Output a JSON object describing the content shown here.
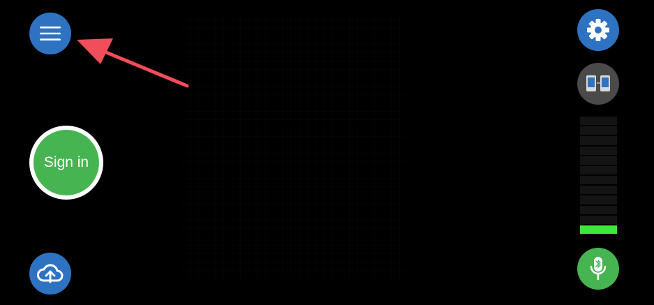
{
  "signin": {
    "label": "Sign in"
  },
  "buttons": {
    "menu_icon": "hamburger-icon",
    "upload_icon": "cloud-upload-icon",
    "settings_icon": "gear-icon",
    "devices_icon": "two-devices-icon",
    "mic_icon": "bluetooth-microphone-icon"
  },
  "level_meter": {
    "segments": 12,
    "active_segments": 1
  },
  "colors": {
    "background": "#000000",
    "blue": "#2e73c2",
    "green": "#47b452",
    "gray": "#4a4a4a",
    "meter_active": "#3ee83a",
    "arrow": "#f24d5a"
  }
}
